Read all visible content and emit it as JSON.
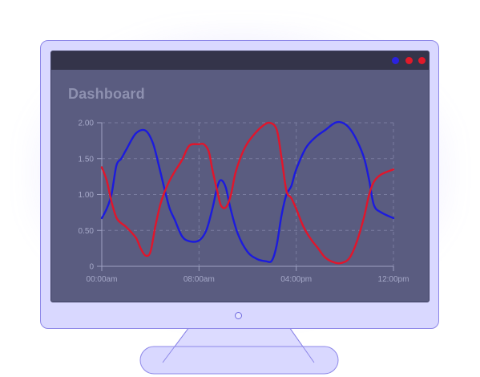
{
  "window": {
    "title": "Dashboard",
    "controls": [
      {
        "name": "blue",
        "color": "#2b22e0"
      },
      {
        "name": "red-1",
        "color": "#e01a2a"
      },
      {
        "name": "red-2",
        "color": "#e01a2a"
      }
    ]
  },
  "colors": {
    "series_blue": "#1c1bdd",
    "series_red": "#e0162c",
    "axis": "#9ea1c2",
    "grid": "#7a7da0",
    "tick_text": "#a6a9c8"
  },
  "chart_data": {
    "type": "line",
    "xlabel": "",
    "ylabel": "",
    "ylim": [
      0,
      2
    ],
    "xlim": [
      0,
      24
    ],
    "y_ticks": [
      "0",
      "0.50",
      "1.00",
      "1.50",
      "2.00"
    ],
    "x_ticks": [
      "00:00am",
      "08:00am",
      "04:00pm",
      "12:00pm"
    ],
    "grid": true,
    "series": [
      {
        "color": "blue",
        "x": [
          0,
          0.4,
          0.8,
          1.2,
          1.6,
          2,
          2.8,
          3.6,
          4.2,
          4.7,
          5.2,
          5.6,
          6,
          6.6,
          7.2,
          8,
          8.6,
          9.1,
          9.5,
          9.8,
          10.2,
          10.6,
          11.2,
          12,
          12.8,
          13.5,
          14,
          14.4,
          14.8,
          15.2,
          15.6,
          16,
          16.8,
          17.6,
          18.4,
          19.2,
          19.8,
          20.4,
          21,
          21.6,
          22,
          22.4,
          23,
          24
        ],
        "y": [
          0.67,
          0.8,
          1.0,
          1.4,
          1.5,
          1.62,
          1.85,
          1.89,
          1.72,
          1.4,
          1.05,
          0.8,
          0.65,
          0.42,
          0.35,
          0.36,
          0.5,
          0.8,
          1.1,
          1.2,
          1.1,
          0.8,
          0.45,
          0.2,
          0.1,
          0.07,
          0.08,
          0.3,
          0.72,
          1.0,
          1.12,
          1.35,
          1.65,
          1.8,
          1.9,
          2.0,
          2.0,
          1.92,
          1.75,
          1.5,
          1.2,
          0.85,
          0.75,
          0.67
        ]
      },
      {
        "color": "red",
        "x": [
          0,
          0.4,
          0.8,
          1.2,
          1.6,
          2,
          2.8,
          3.2,
          3.6,
          4,
          4.4,
          4.8,
          5.2,
          5.6,
          6,
          6.6,
          7.2,
          8,
          8.4,
          8.8,
          9.1,
          9.5,
          9.8,
          10.2,
          10.6,
          11,
          11.5,
          12,
          12.6,
          13.2,
          13.8,
          14.4,
          14.8,
          15.2,
          15.6,
          16,
          16.6,
          17.2,
          17.8,
          18.4,
          19.2,
          19.8,
          20.4,
          21,
          21.6,
          22,
          22.4,
          23,
          24
        ],
        "y": [
          1.38,
          1.2,
          0.9,
          0.68,
          0.6,
          0.55,
          0.4,
          0.25,
          0.15,
          0.2,
          0.55,
          0.85,
          1.05,
          1.2,
          1.32,
          1.48,
          1.68,
          1.7,
          1.7,
          1.6,
          1.35,
          1.05,
          0.85,
          0.82,
          0.98,
          1.3,
          1.55,
          1.72,
          1.85,
          1.95,
          2.0,
          1.9,
          1.5,
          1.05,
          0.95,
          0.8,
          0.55,
          0.38,
          0.25,
          0.12,
          0.05,
          0.05,
          0.12,
          0.35,
          0.7,
          1.0,
          1.18,
          1.28,
          1.35
        ]
      }
    ]
  }
}
